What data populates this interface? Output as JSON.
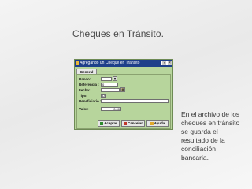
{
  "slide": {
    "title": "Cheques en Tránsito.",
    "description": "En el archivo de los cheques en tránsito se guarda el resultado de la conciliación bancaria."
  },
  "dialog": {
    "title": "Agregando un Cheque en Tránsito",
    "tab_general": "General",
    "fields": {
      "banco_label": "Banco:",
      "banco_value": "",
      "referencia_label": "Referencia :",
      "referencia_value": "0",
      "fecha_label": "Fecha:",
      "fecha_value": "",
      "tipo_label": "Tipo:",
      "tipo_value": "D",
      "beneficiario_label": "Beneficiario :",
      "beneficiario_value": "",
      "valor_label": "Valor:",
      "valor_value": "0.00"
    },
    "buttons": {
      "accept": "Aceptar",
      "cancel": "Cancelar",
      "help": "Ayuda"
    }
  },
  "colors": {
    "dialog_bg": "#b7d59c",
    "titlebar": "#1e3f8a"
  }
}
